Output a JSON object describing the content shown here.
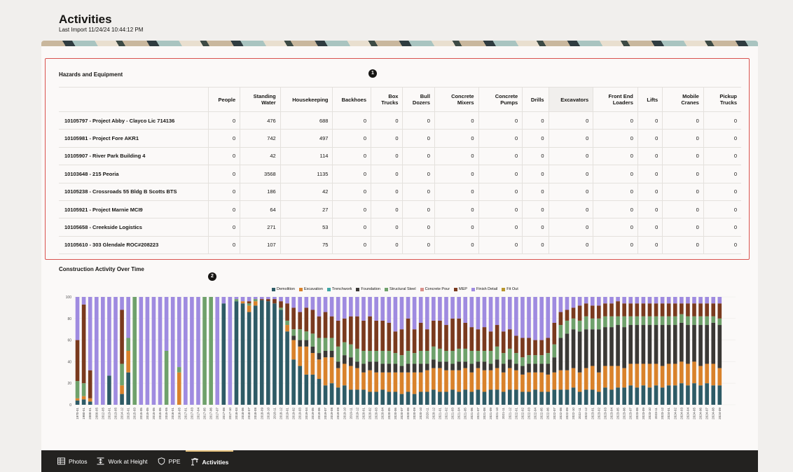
{
  "page": {
    "title": "Activities",
    "last_import": "Last Import 11/24/24 10:44:12 PM"
  },
  "hazards": {
    "title": "Hazards and Equipment",
    "badge": "1",
    "columns": [
      "",
      "People",
      "Standing Water",
      "Housekeeping",
      "Backhoes",
      "Box Trucks",
      "Bull Dozers",
      "Concrete Mixers",
      "Concrete Pumps",
      "Drills",
      "Excavators",
      "Front End Loaders",
      "Lifts",
      "Mobile Cranes",
      "Pickup Trucks"
    ],
    "rows": [
      [
        "10105797 - Project Abby - Clayco Lic 714136",
        "0",
        "476",
        "688",
        "0",
        "0",
        "0",
        "0",
        "0",
        "0",
        "0",
        "0",
        "0",
        "0",
        "0"
      ],
      [
        "10105981 - Project Fore AKR1",
        "0",
        "742",
        "497",
        "0",
        "0",
        "0",
        "0",
        "0",
        "0",
        "0",
        "0",
        "0",
        "0",
        "0"
      ],
      [
        "10105907 - River Park Building 4",
        "0",
        "42",
        "114",
        "0",
        "0",
        "0",
        "0",
        "0",
        "0",
        "0",
        "0",
        "0",
        "0",
        "0"
      ],
      [
        "10103648 - 215 Peoria",
        "0",
        "3568",
        "1135",
        "0",
        "0",
        "0",
        "0",
        "0",
        "0",
        "0",
        "0",
        "0",
        "0",
        "0"
      ],
      [
        "10105238 - Crossroads 55 Bldg B Scotts BTS",
        "0",
        "186",
        "42",
        "0",
        "0",
        "0",
        "0",
        "0",
        "0",
        "0",
        "0",
        "0",
        "0",
        "0"
      ],
      [
        "10105921 - Project Marnie MCI9",
        "0",
        "64",
        "27",
        "0",
        "0",
        "0",
        "0",
        "0",
        "0",
        "0",
        "0",
        "0",
        "0",
        "0"
      ],
      [
        "10105658 - Creekside Logistics",
        "0",
        "271",
        "53",
        "0",
        "0",
        "0",
        "0",
        "0",
        "0",
        "0",
        "0",
        "0",
        "0",
        "0"
      ],
      [
        "10105610 - 303 Glendale ROC#208223",
        "0",
        "107",
        "75",
        "0",
        "0",
        "0",
        "0",
        "0",
        "0",
        "0",
        "0",
        "0",
        "0",
        "0"
      ]
    ]
  },
  "activity": {
    "title": "Construction Activity Over Time",
    "badge": "2"
  },
  "chart_data": {
    "type": "bar",
    "stacked": true,
    "legend_position": "top",
    "ylim": [
      0,
      100
    ],
    "yticks": [
      0,
      20,
      40,
      60,
      80,
      100
    ],
    "categories": [
      "1970-01",
      "1980-01",
      "2000-01",
      "2000-05",
      "2012-05",
      "2013-01",
      "2013-05",
      "2014-12",
      "2015-01",
      "2015-03",
      "2015-05",
      "2015-05",
      "2015-05",
      "2015-05",
      "2015-05",
      "2016-01",
      "2016-05",
      "2017-01",
      "2017-03",
      "2017-04",
      "2017-05",
      "2017-06",
      "2017-07",
      "2017-08",
      "2017-10",
      "2018-03",
      "2018-06",
      "2018-07",
      "2018-08",
      "2018-09",
      "2018-10",
      "2018-11",
      "2018-12",
      "2019-01",
      "2019-02",
      "2019-03",
      "2019-04",
      "2019-05",
      "2019-06",
      "2019-07",
      "2019-08",
      "2019-09",
      "2019-10",
      "2019-11",
      "2019-12",
      "2020-01",
      "2020-02",
      "2020-03",
      "2020-04",
      "2020-05",
      "2020-06",
      "2020-07",
      "2020-08",
      "2020-09",
      "2020-10",
      "2020-11",
      "2020-12",
      "2021-01",
      "2021-02",
      "2021-03",
      "2021-04",
      "2021-05",
      "2021-06",
      "2021-07",
      "2021-08",
      "2021-09",
      "2021-10",
      "2021-11",
      "2021-12",
      "2022-01",
      "2022-02",
      "2022-03",
      "2022-04",
      "2022-05",
      "2022-06",
      "2022-07",
      "2022-08",
      "2022-09",
      "2022-10",
      "2022-11",
      "2022-12",
      "2023-01",
      "2023-02",
      "2023-03",
      "2023-04",
      "2023-05",
      "2023-06",
      "2023-07",
      "2023-08",
      "2023-09",
      "2023-10",
      "2023-11",
      "2023-12",
      "2024-01",
      "2024-02",
      "2024-03",
      "2024-04",
      "2024-05",
      "2024-06",
      "2024-07",
      "2024-08",
      "2024-09",
      "2024-10",
      "2024-11"
    ],
    "series": [
      {
        "name": "Demolition",
        "color": "#2e5b66"
      },
      {
        "name": "Excavation",
        "color": "#d9822b"
      },
      {
        "name": "Trenchwork",
        "color": "#3fa7a6"
      },
      {
        "name": "Foundation",
        "color": "#3a3835"
      },
      {
        "name": "Structural Steel",
        "color": "#6fa16b"
      },
      {
        "name": "Concrete Pour",
        "color": "#d9908a"
      },
      {
        "name": "MEP",
        "color": "#7a3a1e"
      },
      {
        "name": "Finish Detail",
        "color": "#9f8be0"
      },
      {
        "name": "Fit Out",
        "color": "#b8962e"
      }
    ],
    "stacks_note_order": [
      "Demolition",
      "Excavation",
      "Trenchwork",
      "Foundation",
      "Structural Steel",
      "Concrete Pour",
      "MEP",
      "Finish Detail",
      "Fit Out"
    ],
    "values": [
      [
        4,
        2,
        0,
        0,
        16,
        0,
        38,
        40,
        0
      ],
      [
        5,
        3,
        0,
        0,
        12,
        0,
        73,
        7,
        0
      ],
      [
        3,
        3,
        0,
        0,
        0,
        0,
        26,
        68,
        0
      ],
      [
        0,
        0,
        0,
        0,
        0,
        0,
        0,
        100,
        0
      ],
      [
        0,
        0,
        0,
        0,
        0,
        0,
        0,
        100,
        0
      ],
      [
        27,
        0,
        0,
        0,
        0,
        0,
        0,
        73,
        0
      ],
      [
        0,
        0,
        0,
        0,
        0,
        0,
        0,
        100,
        0
      ],
      [
        10,
        8,
        0,
        0,
        20,
        0,
        50,
        12,
        0
      ],
      [
        30,
        20,
        0,
        0,
        12,
        0,
        0,
        38,
        0
      ],
      [
        0,
        0,
        0,
        0,
        100,
        0,
        0,
        0,
        0
      ],
      [
        0,
        0,
        0,
        0,
        0,
        0,
        0,
        100,
        0
      ],
      [
        0,
        0,
        0,
        0,
        0,
        0,
        0,
        100,
        0
      ],
      [
        0,
        0,
        0,
        0,
        0,
        0,
        0,
        100,
        0
      ],
      [
        0,
        0,
        0,
        0,
        0,
        0,
        0,
        100,
        0
      ],
      [
        0,
        0,
        0,
        0,
        50,
        0,
        0,
        50,
        0
      ],
      [
        0,
        0,
        0,
        0,
        0,
        0,
        0,
        100,
        0
      ],
      [
        0,
        30,
        0,
        0,
        5,
        0,
        0,
        65,
        0
      ],
      [
        0,
        0,
        0,
        0,
        0,
        0,
        0,
        100,
        0
      ],
      [
        0,
        0,
        0,
        0,
        0,
        0,
        0,
        100,
        0
      ],
      [
        0,
        0,
        0,
        0,
        0,
        0,
        0,
        100,
        0
      ],
      [
        0,
        0,
        0,
        0,
        100,
        0,
        0,
        0,
        0
      ],
      [
        0,
        0,
        0,
        0,
        100,
        0,
        0,
        0,
        0
      ],
      [
        0,
        0,
        0,
        0,
        0,
        0,
        0,
        100,
        0
      ],
      [
        94,
        0,
        0,
        0,
        0,
        0,
        0,
        6,
        0
      ],
      [
        0,
        0,
        0,
        0,
        0,
        0,
        0,
        100,
        0
      ],
      [
        96,
        0,
        0,
        0,
        2,
        0,
        0,
        2,
        0
      ],
      [
        94,
        2,
        0,
        0,
        0,
        0,
        0,
        4,
        0
      ],
      [
        86,
        6,
        0,
        0,
        2,
        0,
        2,
        4,
        0
      ],
      [
        92,
        4,
        0,
        0,
        2,
        0,
        0,
        2,
        0
      ],
      [
        97,
        0,
        0,
        0,
        0,
        0,
        1,
        2,
        0
      ],
      [
        96,
        0,
        0,
        0,
        0,
        0,
        2,
        2,
        0
      ],
      [
        94,
        0,
        0,
        0,
        0,
        0,
        4,
        2,
        0
      ],
      [
        88,
        0,
        0,
        0,
        2,
        0,
        6,
        4,
        0
      ],
      [
        68,
        6,
        0,
        0,
        4,
        0,
        16,
        6,
        0
      ],
      [
        42,
        18,
        0,
        4,
        6,
        0,
        20,
        10,
        0
      ],
      [
        36,
        18,
        0,
        6,
        10,
        0,
        16,
        14,
        0
      ],
      [
        28,
        26,
        0,
        6,
        8,
        0,
        22,
        10,
        0
      ],
      [
        28,
        20,
        0,
        6,
        12,
        0,
        22,
        12,
        0
      ],
      [
        24,
        18,
        0,
        6,
        14,
        0,
        20,
        18,
        0
      ],
      [
        18,
        26,
        0,
        6,
        12,
        0,
        24,
        14,
        0
      ],
      [
        20,
        24,
        0,
        6,
        12,
        0,
        20,
        18,
        0
      ],
      [
        16,
        18,
        0,
        6,
        14,
        0,
        24,
        22,
        0
      ],
      [
        18,
        20,
        0,
        8,
        12,
        0,
        22,
        20,
        0
      ],
      [
        14,
        22,
        0,
        8,
        12,
        0,
        26,
        18,
        0
      ],
      [
        14,
        20,
        0,
        6,
        12,
        0,
        30,
        18,
        0
      ],
      [
        14,
        16,
        0,
        8,
        12,
        0,
        28,
        22,
        0
      ],
      [
        12,
        20,
        0,
        8,
        10,
        0,
        32,
        18,
        0
      ],
      [
        12,
        18,
        0,
        10,
        10,
        0,
        28,
        22,
        0
      ],
      [
        14,
        16,
        0,
        8,
        12,
        0,
        28,
        22,
        0
      ],
      [
        12,
        18,
        0,
        8,
        12,
        0,
        26,
        24,
        0
      ],
      [
        12,
        18,
        0,
        8,
        10,
        0,
        20,
        32,
        0
      ],
      [
        10,
        20,
        0,
        6,
        10,
        0,
        24,
        30,
        0
      ],
      [
        12,
        18,
        0,
        8,
        12,
        0,
        30,
        20,
        0
      ],
      [
        10,
        20,
        0,
        8,
        10,
        0,
        22,
        30,
        0
      ],
      [
        12,
        18,
        0,
        8,
        12,
        0,
        26,
        24,
        0
      ],
      [
        12,
        20,
        0,
        6,
        12,
        0,
        20,
        30,
        0
      ],
      [
        14,
        20,
        0,
        8,
        12,
        0,
        24,
        22,
        0
      ],
      [
        12,
        22,
        0,
        6,
        12,
        0,
        26,
        22,
        0
      ],
      [
        12,
        20,
        0,
        8,
        10,
        0,
        24,
        26,
        0
      ],
      [
        14,
        18,
        0,
        6,
        12,
        0,
        30,
        20,
        0
      ],
      [
        12,
        20,
        0,
        8,
        12,
        0,
        28,
        20,
        0
      ],
      [
        14,
        20,
        0,
        6,
        12,
        0,
        24,
        24,
        0
      ],
      [
        12,
        18,
        0,
        8,
        12,
        0,
        22,
        28,
        0
      ],
      [
        14,
        20,
        0,
        6,
        10,
        0,
        20,
        30,
        0
      ],
      [
        12,
        20,
        0,
        8,
        10,
        0,
        22,
        28,
        0
      ],
      [
        14,
        18,
        0,
        6,
        12,
        0,
        18,
        32,
        0
      ],
      [
        14,
        20,
        0,
        8,
        12,
        0,
        20,
        26,
        0
      ],
      [
        12,
        18,
        0,
        8,
        10,
        0,
        20,
        32,
        0
      ],
      [
        14,
        20,
        0,
        8,
        10,
        0,
        18,
        30,
        0
      ],
      [
        14,
        18,
        0,
        6,
        10,
        0,
        16,
        36,
        0
      ],
      [
        12,
        16,
        0,
        8,
        8,
        0,
        18,
        38,
        0
      ],
      [
        12,
        18,
        0,
        8,
        8,
        0,
        16,
        38,
        0
      ],
      [
        14,
        16,
        0,
        8,
        8,
        0,
        14,
        40,
        0
      ],
      [
        12,
        18,
        0,
        8,
        8,
        0,
        14,
        40,
        0
      ],
      [
        12,
        16,
        0,
        10,
        10,
        0,
        14,
        38,
        0
      ],
      [
        14,
        16,
        0,
        14,
        12,
        0,
        20,
        24,
        0
      ],
      [
        14,
        18,
        0,
        30,
        12,
        0,
        12,
        14,
        0
      ],
      [
        14,
        18,
        0,
        34,
        12,
        0,
        10,
        12,
        0
      ],
      [
        16,
        18,
        0,
        36,
        10,
        0,
        10,
        10,
        0
      ],
      [
        12,
        18,
        0,
        38,
        10,
        0,
        14,
        8,
        0
      ],
      [
        14,
        20,
        0,
        36,
        12,
        0,
        12,
        6,
        0
      ],
      [
        14,
        22,
        0,
        34,
        10,
        0,
        12,
        8,
        0
      ],
      [
        12,
        18,
        0,
        40,
        10,
        0,
        12,
        8,
        0
      ],
      [
        16,
        20,
        0,
        36,
        10,
        0,
        12,
        6,
        0
      ],
      [
        14,
        22,
        0,
        36,
        10,
        0,
        12,
        6,
        0
      ],
      [
        16,
        20,
        0,
        38,
        8,
        0,
        14,
        4,
        0
      ],
      [
        16,
        18,
        0,
        38,
        10,
        0,
        12,
        6,
        0
      ],
      [
        18,
        20,
        0,
        36,
        8,
        0,
        12,
        6,
        0
      ],
      [
        16,
        22,
        0,
        36,
        8,
        0,
        12,
        6,
        0
      ],
      [
        18,
        20,
        0,
        36,
        8,
        0,
        12,
        6,
        0
      ],
      [
        16,
        22,
        0,
        36,
        8,
        0,
        12,
        6,
        0
      ],
      [
        18,
        20,
        0,
        36,
        8,
        0,
        12,
        6,
        0
      ],
      [
        16,
        20,
        0,
        38,
        8,
        0,
        12,
        6,
        0
      ],
      [
        18,
        20,
        0,
        36,
        8,
        0,
        12,
        6,
        0
      ],
      [
        18,
        20,
        0,
        36,
        8,
        0,
        12,
        6,
        0
      ],
      [
        20,
        20,
        0,
        36,
        8,
        0,
        10,
        6,
        0
      ],
      [
        18,
        20,
        0,
        36,
        8,
        0,
        12,
        6,
        0
      ],
      [
        20,
        20,
        0,
        34,
        8,
        0,
        12,
        6,
        0
      ],
      [
        18,
        18,
        0,
        38,
        8,
        0,
        12,
        6,
        0
      ],
      [
        20,
        18,
        0,
        36,
        8,
        0,
        12,
        6,
        0
      ],
      [
        18,
        20,
        0,
        38,
        6,
        0,
        12,
        6,
        0
      ],
      [
        18,
        16,
        0,
        40,
        6,
        0,
        14,
        6,
        0
      ]
    ]
  },
  "tabs": [
    {
      "label": "Photos",
      "icon": "photos-icon",
      "active": false
    },
    {
      "label": "Work at Height",
      "icon": "work-at-height-icon",
      "active": false
    },
    {
      "label": "PPE",
      "icon": "shield-icon",
      "active": false
    },
    {
      "label": "Activities",
      "icon": "crane-icon",
      "active": true
    }
  ]
}
